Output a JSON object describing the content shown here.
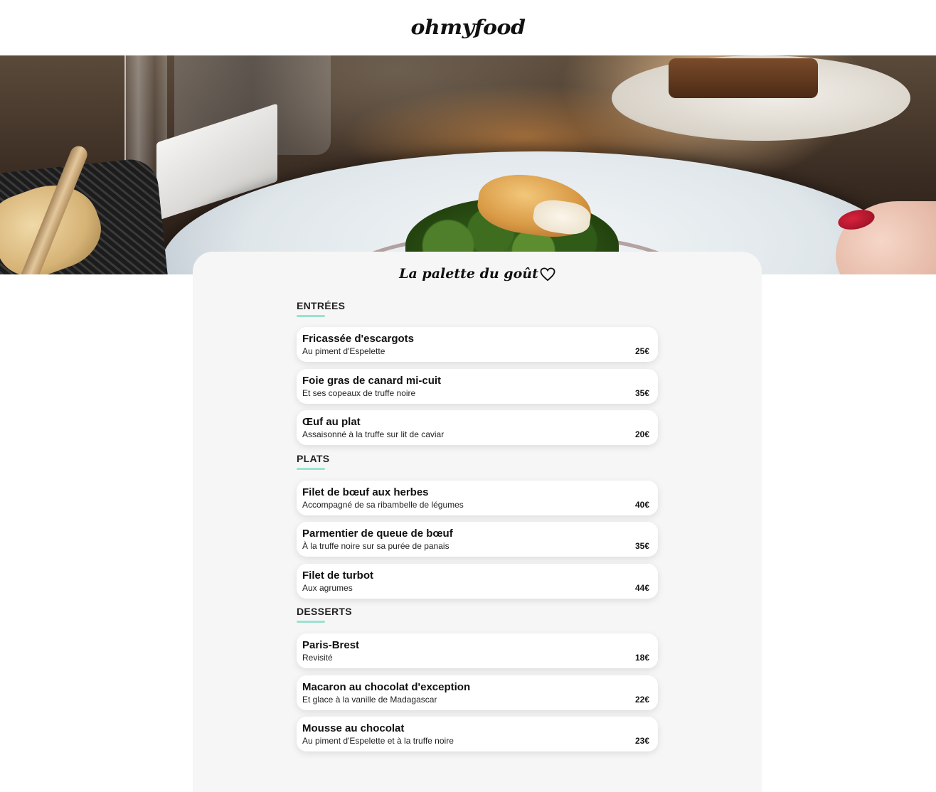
{
  "header": {
    "logo": "ohmyfood"
  },
  "hero": {
    "image_alt": "Dish of fish on greens with sauce on a white plate"
  },
  "restaurant": {
    "name": "La palette du goût"
  },
  "colors": {
    "accent": "#99e2d0",
    "panel_bg": "#f6f6f6",
    "card_bg": "#ffffff"
  },
  "menu": {
    "sections": [
      {
        "title": "ENTRÉES",
        "dishes": [
          {
            "name": "Fricassée d'escargots",
            "desc": "Au piment d'Espelette",
            "price": "25€"
          },
          {
            "name": "Foie gras de canard mi-cuit",
            "desc": "Et ses copeaux de truffe noire",
            "price": "35€"
          },
          {
            "name": "Œuf au plat",
            "desc": "Assaisonné à la truffe sur lit de caviar",
            "price": "20€"
          }
        ]
      },
      {
        "title": "PLATS",
        "dishes": [
          {
            "name": "Filet de bœuf aux herbes",
            "desc": "Accompagné de sa ribambelle de légumes",
            "price": "40€"
          },
          {
            "name": "Parmentier de queue de bœuf",
            "desc": "À la truffe noire sur sa purée de panais",
            "price": "35€"
          },
          {
            "name": "Filet de turbot",
            "desc": "Aux agrumes",
            "price": "44€"
          }
        ]
      },
      {
        "title": "DESSERTS",
        "dishes": [
          {
            "name": "Paris-Brest",
            "desc": "Revisité",
            "price": "18€"
          },
          {
            "name": "Macaron au chocolat d'exception",
            "desc": "Et glace à la vanille de Madagascar",
            "price": "22€"
          },
          {
            "name": "Mousse au chocolat",
            "desc": "Au piment d'Espelette et à la truffe noire",
            "price": "23€"
          }
        ]
      }
    ]
  }
}
